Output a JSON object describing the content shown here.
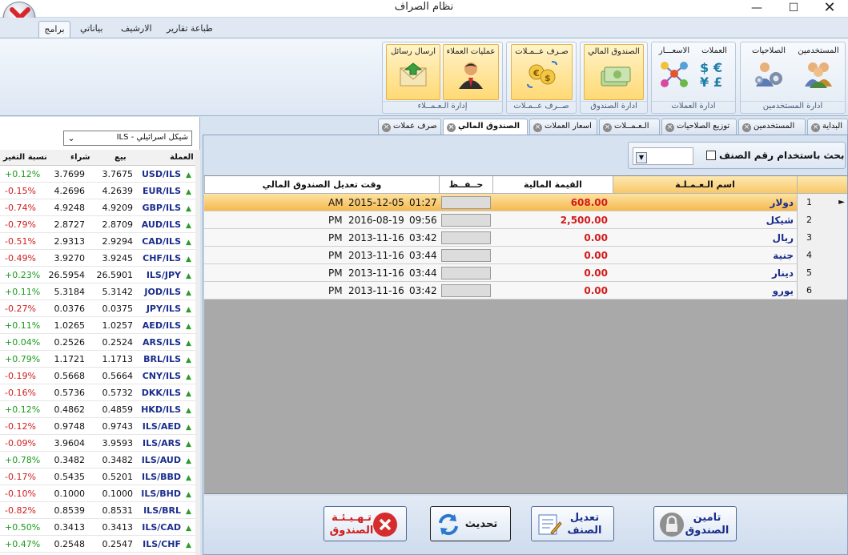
{
  "window": {
    "title": "نظام الصراف"
  },
  "ribbon_tabs": [
    "برامج",
    "بياناتي",
    "الارشيف",
    "طباعة تقارير"
  ],
  "ribbon_groups": [
    {
      "caption": "ادارة المستخدمين",
      "buttons": [
        "المستخدمين",
        "الصلاحيات"
      ]
    },
    {
      "caption": "ادارة العملات",
      "buttons": [
        "العملات",
        "الاسعـــار"
      ]
    },
    {
      "caption": "ادارة الصندوق",
      "buttons": [
        "الصندوق المالي"
      ]
    },
    {
      "caption": "صــرف عــمـلات",
      "buttons": [
        "صـرف عــمـلات"
      ]
    },
    {
      "caption": "إدارة الـعـمــلاء",
      "buttons": [
        "عمليات العملاء",
        "ارسال رسائل"
      ]
    }
  ],
  "left_panel": {
    "currency_select": "ILS - شيكل اسرائيلي",
    "headers": {
      "pair": "العملة",
      "sell": "بيع",
      "buy": "شراء",
      "change": "نسبة التغير"
    },
    "rows": [
      {
        "pair": "USD/ILS",
        "sell": "3.7675",
        "buy": "3.7699",
        "change": "+0.12%",
        "dir": "pos"
      },
      {
        "pair": "EUR/ILS",
        "sell": "4.2639",
        "buy": "4.2696",
        "change": "-0.15%",
        "dir": "neg"
      },
      {
        "pair": "GBP/ILS",
        "sell": "4.9209",
        "buy": "4.9248",
        "change": "-0.74%",
        "dir": "neg"
      },
      {
        "pair": "AUD/ILS",
        "sell": "2.8709",
        "buy": "2.8727",
        "change": "-0.79%",
        "dir": "neg"
      },
      {
        "pair": "CAD/ILS",
        "sell": "2.9294",
        "buy": "2.9313",
        "change": "-0.51%",
        "dir": "neg"
      },
      {
        "pair": "CHF/ILS",
        "sell": "3.9245",
        "buy": "3.9270",
        "change": "-0.49%",
        "dir": "neg"
      },
      {
        "pair": "ILS/JPY",
        "sell": "26.5901",
        "buy": "26.5954",
        "change": "+0.23%",
        "dir": "pos"
      },
      {
        "pair": "JOD/ILS",
        "sell": "5.3142",
        "buy": "5.3184",
        "change": "+0.11%",
        "dir": "pos"
      },
      {
        "pair": "JPY/ILS",
        "sell": "0.0375",
        "buy": "0.0376",
        "change": "-0.27%",
        "dir": "neg"
      },
      {
        "pair": "AED/ILS",
        "sell": "1.0257",
        "buy": "1.0265",
        "change": "+0.11%",
        "dir": "pos"
      },
      {
        "pair": "ARS/ILS",
        "sell": "0.2524",
        "buy": "0.2526",
        "change": "+0.04%",
        "dir": "pos"
      },
      {
        "pair": "BRL/ILS",
        "sell": "1.1713",
        "buy": "1.1721",
        "change": "+0.79%",
        "dir": "pos"
      },
      {
        "pair": "CNY/ILS",
        "sell": "0.5664",
        "buy": "0.5668",
        "change": "-0.19%",
        "dir": "neg"
      },
      {
        "pair": "DKK/ILS",
        "sell": "0.5732",
        "buy": "0.5736",
        "change": "-0.16%",
        "dir": "neg"
      },
      {
        "pair": "HKD/ILS",
        "sell": "0.4859",
        "buy": "0.4862",
        "change": "+0.12%",
        "dir": "pos"
      },
      {
        "pair": "ILS/AED",
        "sell": "0.9743",
        "buy": "0.9748",
        "change": "-0.12%",
        "dir": "neg"
      },
      {
        "pair": "ILS/ARS",
        "sell": "3.9593",
        "buy": "3.9604",
        "change": "-0.09%",
        "dir": "neg"
      },
      {
        "pair": "ILS/AUD",
        "sell": "0.3482",
        "buy": "0.3482",
        "change": "+0.78%",
        "dir": "pos"
      },
      {
        "pair": "ILS/BBD",
        "sell": "0.5201",
        "buy": "0.5435",
        "change": "-0.17%",
        "dir": "neg"
      },
      {
        "pair": "ILS/BHD",
        "sell": "0.1000",
        "buy": "0.1000",
        "change": "-0.10%",
        "dir": "neg"
      },
      {
        "pair": "ILS/BRL",
        "sell": "0.8531",
        "buy": "0.8539",
        "change": "-0.82%",
        "dir": "neg"
      },
      {
        "pair": "ILS/CAD",
        "sell": "0.3413",
        "buy": "0.3413",
        "change": "+0.50%",
        "dir": "pos"
      },
      {
        "pair": "ILS/CHF",
        "sell": "0.2547",
        "buy": "0.2548",
        "change": "+0.47%",
        "dir": "pos"
      }
    ]
  },
  "doc_tabs": [
    "البداية",
    "المستخدمين",
    "توزيع الصلاحيات",
    "الـعـمــلات",
    "اسعار العملات",
    "الصندوق المالي",
    "صرف عملات"
  ],
  "active_doc_tab": 5,
  "search": {
    "label": "بحث باستخدام رقم الصنف",
    "value": ""
  },
  "grid": {
    "headers": {
      "name": "اسم الـعـمـلـة",
      "value": "القيمة المالية",
      "save": "حــفــظ",
      "time": "وقت تعديل الصندوق المالي"
    },
    "rows": [
      {
        "num": "1",
        "name": "دولار",
        "value": "608.00",
        "date": "2015-12-05",
        "ampm": "AM",
        "time": "01:27"
      },
      {
        "num": "2",
        "name": "شيكل",
        "value": "2,500.00",
        "date": "2016-08-19",
        "ampm": "PM",
        "time": "09:56"
      },
      {
        "num": "3",
        "name": "ريال",
        "value": "0.00",
        "date": "2013-11-16",
        "ampm": "PM",
        "time": "03:42"
      },
      {
        "num": "4",
        "name": "جنية",
        "value": "0.00",
        "date": "2013-11-16",
        "ampm": "PM",
        "time": "03:44"
      },
      {
        "num": "5",
        "name": "دينار",
        "value": "0.00",
        "date": "2013-11-16",
        "ampm": "PM",
        "time": "03:44"
      },
      {
        "num": "6",
        "name": "يورو",
        "value": "0.00",
        "date": "2013-11-16",
        "ampm": "PM",
        "time": "03:42"
      }
    ]
  },
  "bottom_buttons": [
    {
      "label": "تامين الصندوق",
      "icon": "lock-icon"
    },
    {
      "label": "تعديل الصنف",
      "icon": "edit-icon"
    },
    {
      "label": "تحديث",
      "icon": "refresh-icon"
    },
    {
      "label": "تـهـيـئـة الصندوق",
      "icon": "cancel-icon"
    }
  ],
  "colors": {
    "accent": "#1a2d8c",
    "negative": "#d01c1c",
    "positive": "#1b9a1b",
    "selected_row": "#f5b94d"
  }
}
